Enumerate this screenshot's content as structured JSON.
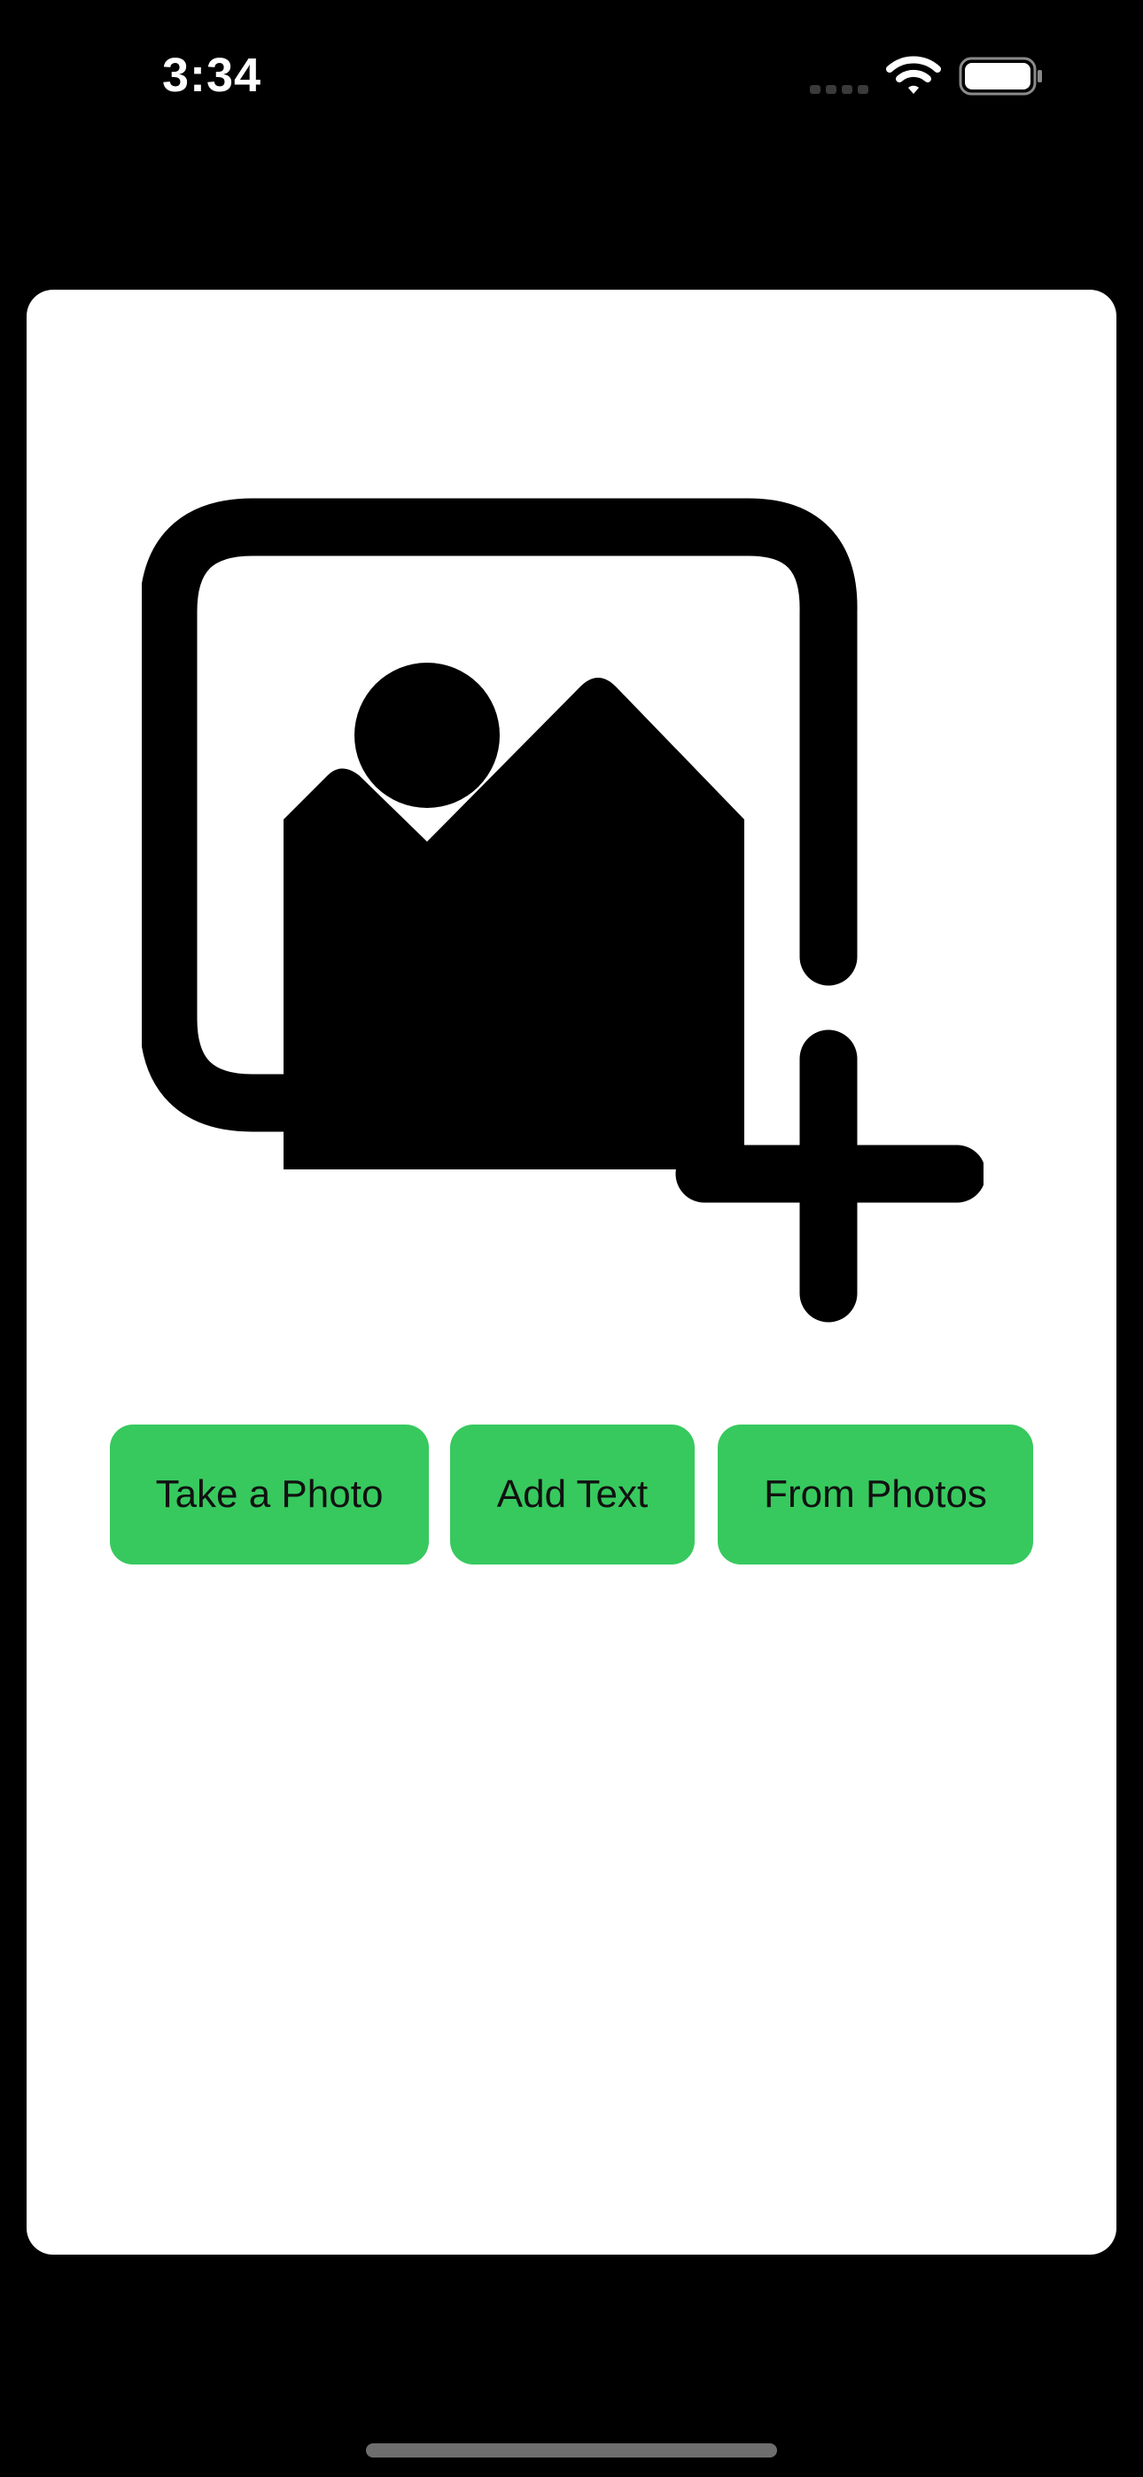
{
  "status_bar": {
    "time": "3:34",
    "icons": [
      "signal-icon",
      "wifi-icon",
      "battery-icon"
    ]
  },
  "main": {
    "icon": "add-photo-icon",
    "buttons": {
      "take_photo": "Take a Photo",
      "add_text": "Add Text",
      "from_photos": "From Photos"
    }
  },
  "colors": {
    "background": "#000000",
    "card": "#ffffff",
    "button": "#37c95e",
    "button_text": "#111111",
    "icon": "#000000"
  }
}
